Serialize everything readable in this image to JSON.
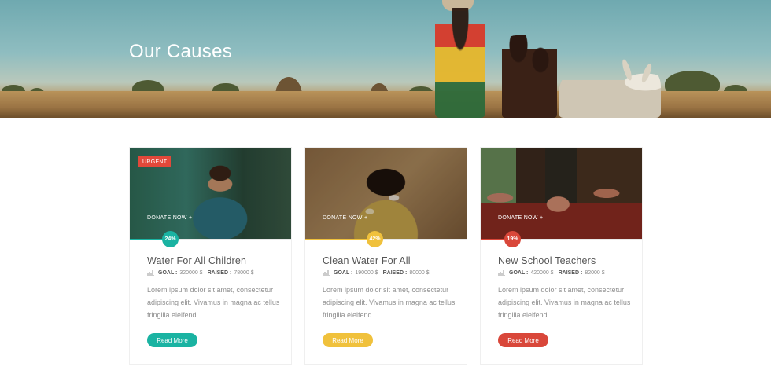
{
  "hero": {
    "title": "Our Causes"
  },
  "causes": [
    {
      "urgent_label": "URGENT",
      "donate_label": "DONATE NOW +",
      "progress_percent": 24,
      "progress_label": "24%",
      "title": "Water For All Children",
      "goal_label": "GOAL :",
      "goal_value": "320000 $",
      "raised_label": "RAISED :",
      "raised_value": "78000 $",
      "description": "Lorem ipsum dolor sit amet, consectetur adipiscing elit. Vivamus in magna ac tellus fringilla eleifend.",
      "button_label": "Read More",
      "accent_color": "#1ab3a2"
    },
    {
      "donate_label": "DONATE NOW +",
      "progress_percent": 42,
      "progress_label": "42%",
      "title": "Clean Water For All",
      "goal_label": "GOAL :",
      "goal_value": "190000 $",
      "raised_label": "RAISED :",
      "raised_value": "80000 $",
      "description": "Lorem ipsum dolor sit amet, consectetur adipiscing elit. Vivamus in magna ac tellus fringilla eleifend.",
      "button_label": "Read More",
      "accent_color": "#f0c13c"
    },
    {
      "donate_label": "DONATE NOW +",
      "progress_percent": 19,
      "progress_label": "19%",
      "title": "New School Teachers",
      "goal_label": "GOAL :",
      "goal_value": "420000 $",
      "raised_label": "RAISED :",
      "raised_value": "82000 $",
      "description": "Lorem ipsum dolor sit amet, consectetur adipiscing elit. Vivamus in magna ac tellus fringilla eleifend.",
      "button_label": "Read More",
      "accent_color": "#d9473a"
    }
  ]
}
